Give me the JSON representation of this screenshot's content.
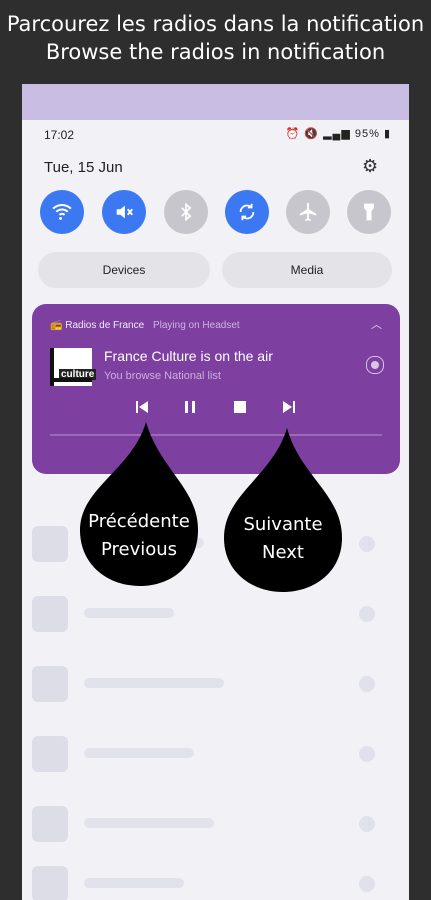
{
  "caption": {
    "line1": "Parcourez les radios dans la notification",
    "line2": "Browse the radios in notification"
  },
  "status_bar": {
    "time": "17:02",
    "battery": "95%"
  },
  "panel": {
    "date": "Tue, 15 Jun",
    "quick_toggles": [
      {
        "name": "wifi",
        "icon": "wifi-icon",
        "state": "on"
      },
      {
        "name": "sound",
        "icon": "mute-icon",
        "state": "on"
      },
      {
        "name": "bluetooth",
        "icon": "bluetooth-icon",
        "state": "off"
      },
      {
        "name": "auto-rotate",
        "icon": "rotate-icon",
        "state": "on"
      },
      {
        "name": "airplane",
        "icon": "airplane-icon",
        "state": "off"
      },
      {
        "name": "flashlight",
        "icon": "flashlight-icon",
        "state": "off"
      }
    ],
    "devices_label": "Devices",
    "media_label": "Media"
  },
  "media_card": {
    "app_name": "Radios de France",
    "output": "Playing on Headset",
    "title": "France Culture is on the air",
    "subtitle": "You browse National list",
    "logo_text": "culture",
    "controls": [
      "previous",
      "pause",
      "stop",
      "next"
    ],
    "accent_color": "#7d3fa0"
  },
  "callouts": {
    "previous": {
      "line1": "Précédente",
      "line2": "Previous"
    },
    "next": {
      "line1": "Suivante",
      "line2": "Next"
    }
  },
  "colors": {
    "toggle_on": "#3b78f2",
    "toggle_off": "#c6c6cc"
  }
}
